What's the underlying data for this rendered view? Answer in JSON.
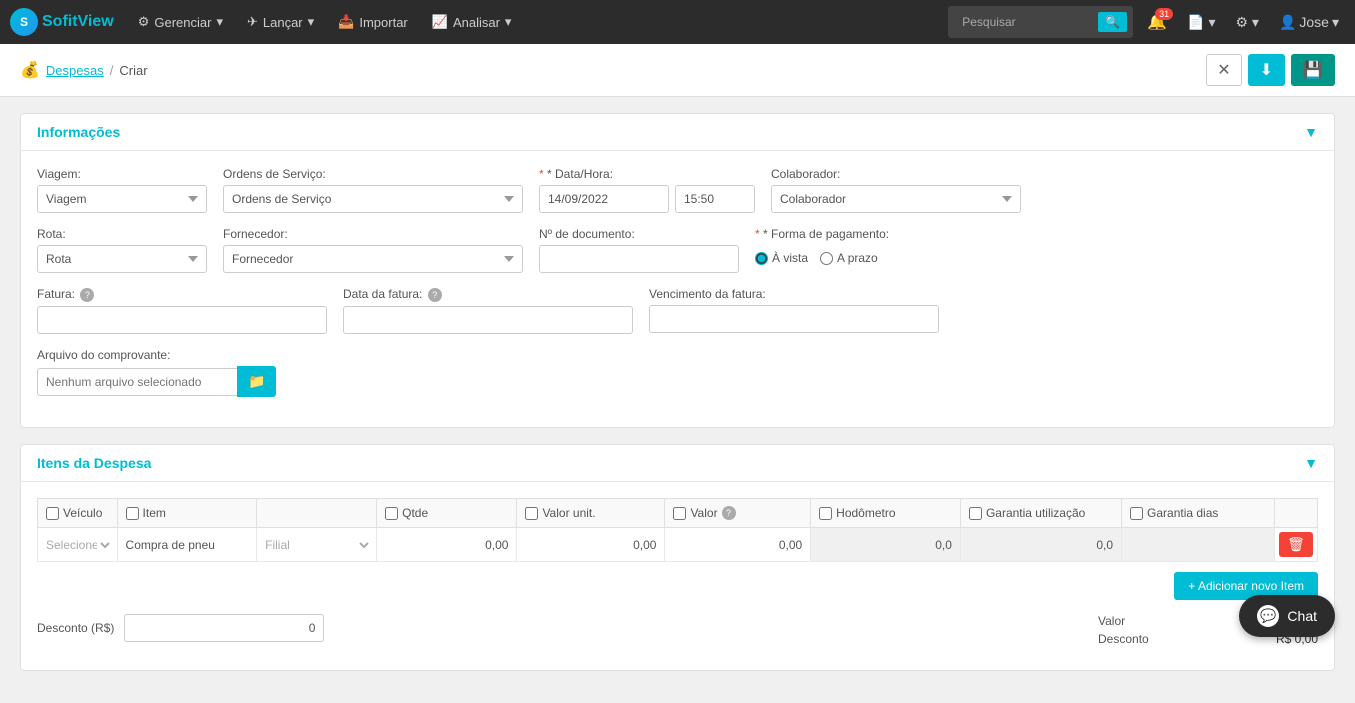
{
  "brand": {
    "logo_text": "S",
    "name_part1": "Sofit",
    "name_part2": "View"
  },
  "navbar": {
    "items": [
      {
        "label": "Gerenciar",
        "icon": "⚙"
      },
      {
        "label": "Lançar",
        "icon": "✈"
      },
      {
        "label": "Importar",
        "icon": "📥"
      },
      {
        "label": "Analisar",
        "icon": "📈"
      }
    ],
    "search_placeholder": "Pesquisar",
    "notification_count": "31",
    "user_name": "Jose"
  },
  "breadcrumb": {
    "icon": "💰",
    "parent": "Despesas",
    "separator": "/",
    "current": "Criar"
  },
  "actions": {
    "close_label": "✕",
    "download_label": "⬇",
    "save_label": "💾"
  },
  "section_informacoes": {
    "title": "Informações",
    "toggle": "▼",
    "fields": {
      "viagem_label": "Viagem:",
      "viagem_placeholder": "Viagem",
      "ordens_label": "Ordens de Serviço:",
      "ordens_placeholder": "Ordens de Serviço",
      "data_hora_label": "* Data/Hora:",
      "data_value": "14/09/2022",
      "hora_value": "15:50",
      "colaborador_label": "Colaborador:",
      "colaborador_placeholder": "Colaborador",
      "rota_label": "Rota:",
      "rota_placeholder": "Rota",
      "fornecedor_label": "Fornecedor:",
      "fornecedor_placeholder": "Fornecedor",
      "num_doc_label": "Nº de documento:",
      "forma_pag_label": "* Forma de pagamento:",
      "avista_label": "À vista",
      "aprazo_label": "A prazo",
      "fatura_label": "Fatura:",
      "fatura_help": "?",
      "data_fatura_label": "Data da fatura:",
      "data_fatura_help": "?",
      "vencimento_label": "Vencimento da fatura:",
      "arquivo_label": "Arquivo do comprovante:",
      "arquivo_placeholder": "Nenhum arquivo selecionado",
      "arquivo_btn": "📁"
    }
  },
  "section_itens": {
    "title": "Itens da Despesa",
    "toggle": "▼",
    "table_headers": {
      "veiculo": "Veículo",
      "item": "Item",
      "qtde": "Qtde",
      "valor_unit": "Valor unit.",
      "valor": "Valor",
      "hodometro": "Hodômetro",
      "garantia_util": "Garantia utilização",
      "garantia_dias": "Garantia dias"
    },
    "row": {
      "selecione": "Selecione",
      "item_name": "Compra de pneu",
      "filial_placeholder": "Filial",
      "qtde": "0,00",
      "valor_unit": "0,00",
      "valor": "0,00",
      "hodometro": "0,0",
      "garantia_util": "0,0"
    },
    "add_item_label": "+ Adicionar novo Item"
  },
  "summary": {
    "desconto_label": "Desconto (R$)",
    "desconto_value": "0",
    "valor_label": "Valor",
    "valor_amount": "R$ 0,00",
    "desconto_sum_label": "Desconto",
    "desconto_sum_amount": "R$ 0,00"
  },
  "chat": {
    "label": "Chat"
  }
}
